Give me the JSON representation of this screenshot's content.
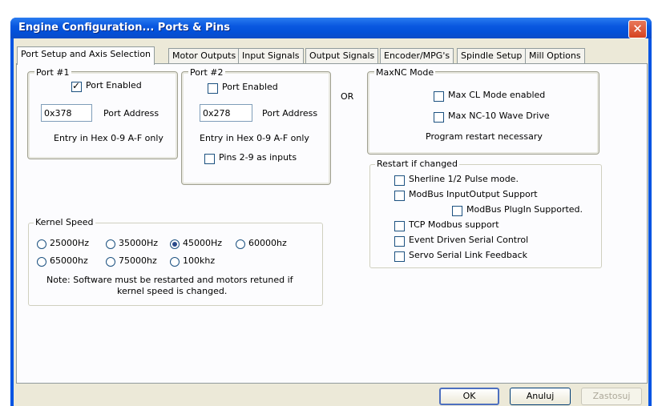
{
  "window": {
    "title": "Engine Configuration... Ports & Pins",
    "close_glyph": "✕"
  },
  "tabs": [
    {
      "label": "Port Setup and Axis Selection",
      "active": true
    },
    {
      "label": "Motor Outputs",
      "active": false
    },
    {
      "label": "Input Signals",
      "active": false
    },
    {
      "label": "Output Signals",
      "active": false
    },
    {
      "label": "Encoder/MPG's",
      "active": false
    },
    {
      "label": "Spindle Setup",
      "active": false
    },
    {
      "label": "Mill Options",
      "active": false
    }
  ],
  "port1": {
    "legend": "Port #1",
    "enabled_label": "Port Enabled",
    "enabled": true,
    "address_value": "0x378",
    "address_label": "Port Address",
    "hint": "Entry in Hex 0-9 A-F only"
  },
  "port2": {
    "legend": "Port #2",
    "enabled_label": "Port Enabled",
    "enabled": false,
    "address_value": "0x278",
    "address_label": "Port Address",
    "hint": "Entry in Hex 0-9 A-F only",
    "pins_label": "Pins 2-9 as inputs",
    "pins_checked": false
  },
  "or_label": "OR",
  "maxnc": {
    "legend": "MaxNC Mode",
    "cl_label": "Max CL Mode enabled",
    "wave_label": "Max NC-10 Wave Drive",
    "note": "Program restart necessary"
  },
  "restart": {
    "legend": "Restart if changed",
    "items": [
      "Sherline 1/2 Pulse mode.",
      "ModBus InputOutput Support",
      "ModBus PlugIn Supported.",
      "TCP Modbus support",
      "Event Driven Serial Control",
      "Servo Serial Link Feedback"
    ]
  },
  "kernel": {
    "legend": "Kernel Speed",
    "options": [
      "25000Hz",
      "35000Hz",
      "45000Hz",
      "60000hz",
      "65000hz",
      "75000hz",
      "100khz"
    ],
    "selected": "45000Hz",
    "note_line1": "Note: Software must be restarted and motors retuned if",
    "note_line2": "kernel speed is changed."
  },
  "buttons": {
    "ok": "OK",
    "cancel": "Anuluj",
    "apply": "Zastosuj"
  }
}
